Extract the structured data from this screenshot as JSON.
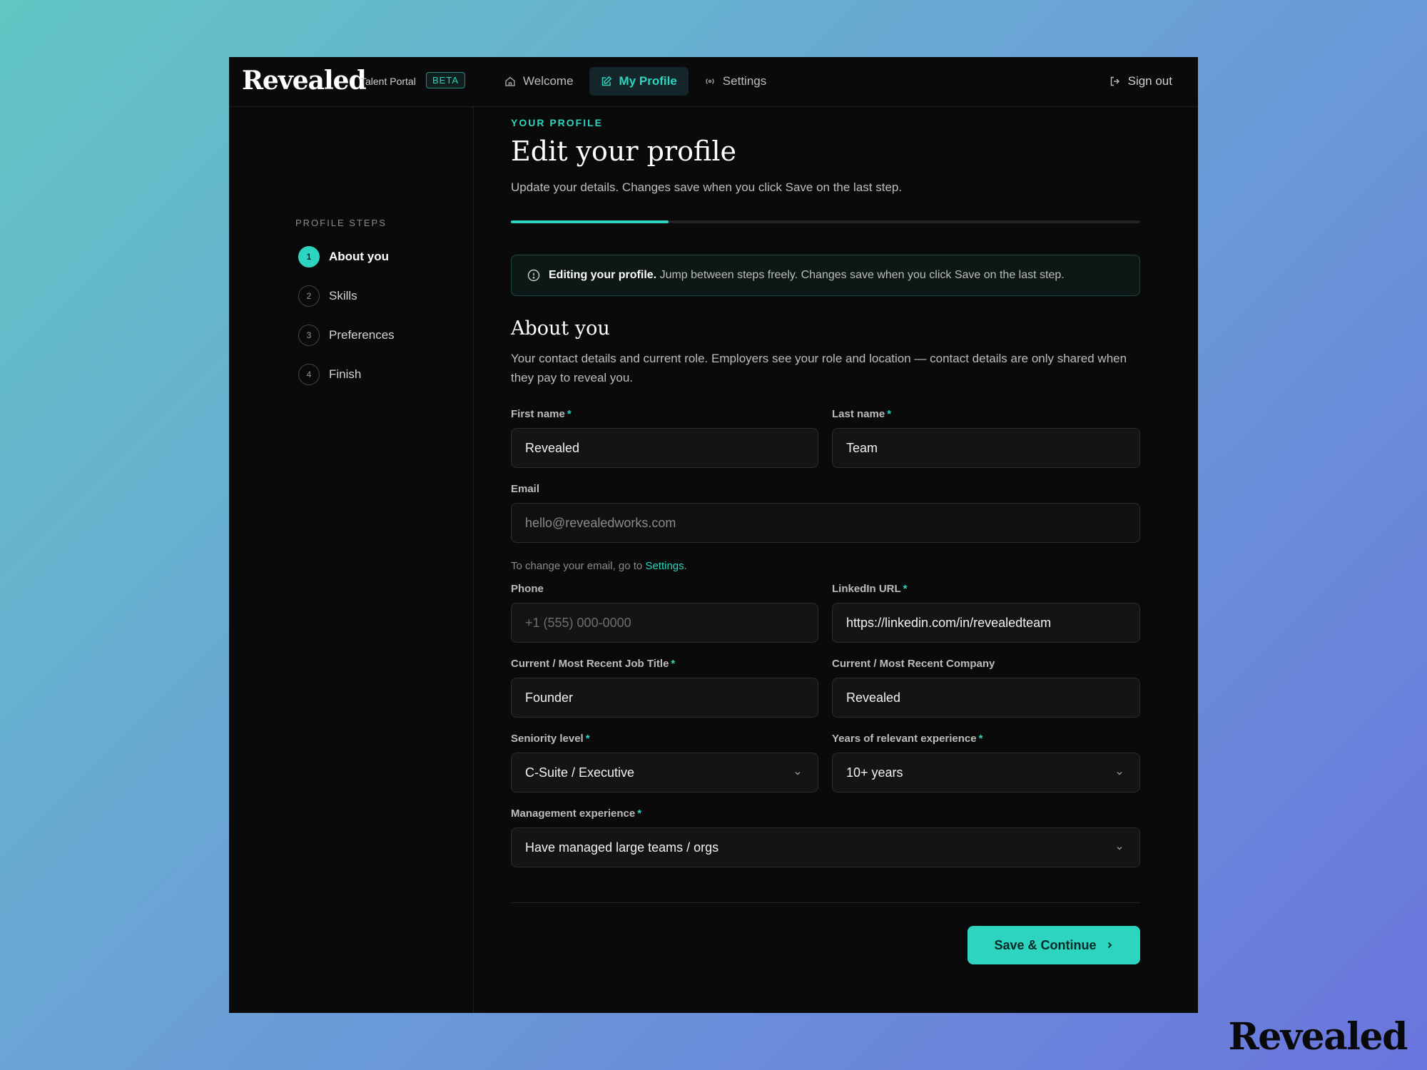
{
  "brand": {
    "name": "Revealed",
    "portal": "Talent Portal",
    "badge": "BETA"
  },
  "nav": {
    "items": [
      {
        "label": "Welcome",
        "icon": "home-icon"
      },
      {
        "label": "My Profile",
        "icon": "edit-icon",
        "active": true
      },
      {
        "label": "Settings",
        "icon": "broadcast-icon"
      }
    ],
    "signout": "Sign out"
  },
  "sidebar": {
    "title": "PROFILE STEPS",
    "steps": [
      {
        "num": "1",
        "label": "About you",
        "active": true
      },
      {
        "num": "2",
        "label": "Skills"
      },
      {
        "num": "3",
        "label": "Preferences"
      },
      {
        "num": "4",
        "label": "Finish"
      }
    ]
  },
  "header": {
    "eyebrow": "YOUR PROFILE",
    "title": "Edit your profile",
    "subtitle": "Update your details. Changes save when you click Save on the last step.",
    "progress": 0.25
  },
  "notice": {
    "bold": "Editing your profile.",
    "text": "Jump between steps freely. Changes save when you click Save on the last step."
  },
  "section": {
    "title": "About you",
    "description": "Your contact details and current role. Employers see your role and location — contact details are only shared when they pay to reveal you."
  },
  "form": {
    "first_name": {
      "label": "First name",
      "value": "Revealed"
    },
    "last_name": {
      "label": "Last name",
      "value": "Team"
    },
    "email": {
      "label": "Email",
      "value": "hello@revealedworks.com"
    },
    "email_help": {
      "prefix": "To change your email, go to ",
      "link": "Settings",
      "suffix": "."
    },
    "phone": {
      "label": "Phone",
      "placeholder": "+1 (555) 000-0000"
    },
    "linkedin": {
      "label": "LinkedIn URL",
      "value": "https://linkedin.com/in/revealedteam"
    },
    "job_title": {
      "label": "Current / Most Recent Job Title",
      "value": "Founder"
    },
    "company": {
      "label": "Current / Most Recent Company",
      "value": "Revealed"
    },
    "seniority": {
      "label": "Seniority level",
      "value": "C-Suite / Executive"
    },
    "experience": {
      "label": "Years of relevant experience",
      "value": "10+ years"
    },
    "management": {
      "label": "Management experience",
      "value": "Have managed large teams / orgs"
    },
    "required_mark": "*"
  },
  "actions": {
    "save": "Save & Continue"
  },
  "footer_logo": "Revealed",
  "colors": {
    "accent": "#2dd4bf",
    "background": "#0a0a0a"
  }
}
